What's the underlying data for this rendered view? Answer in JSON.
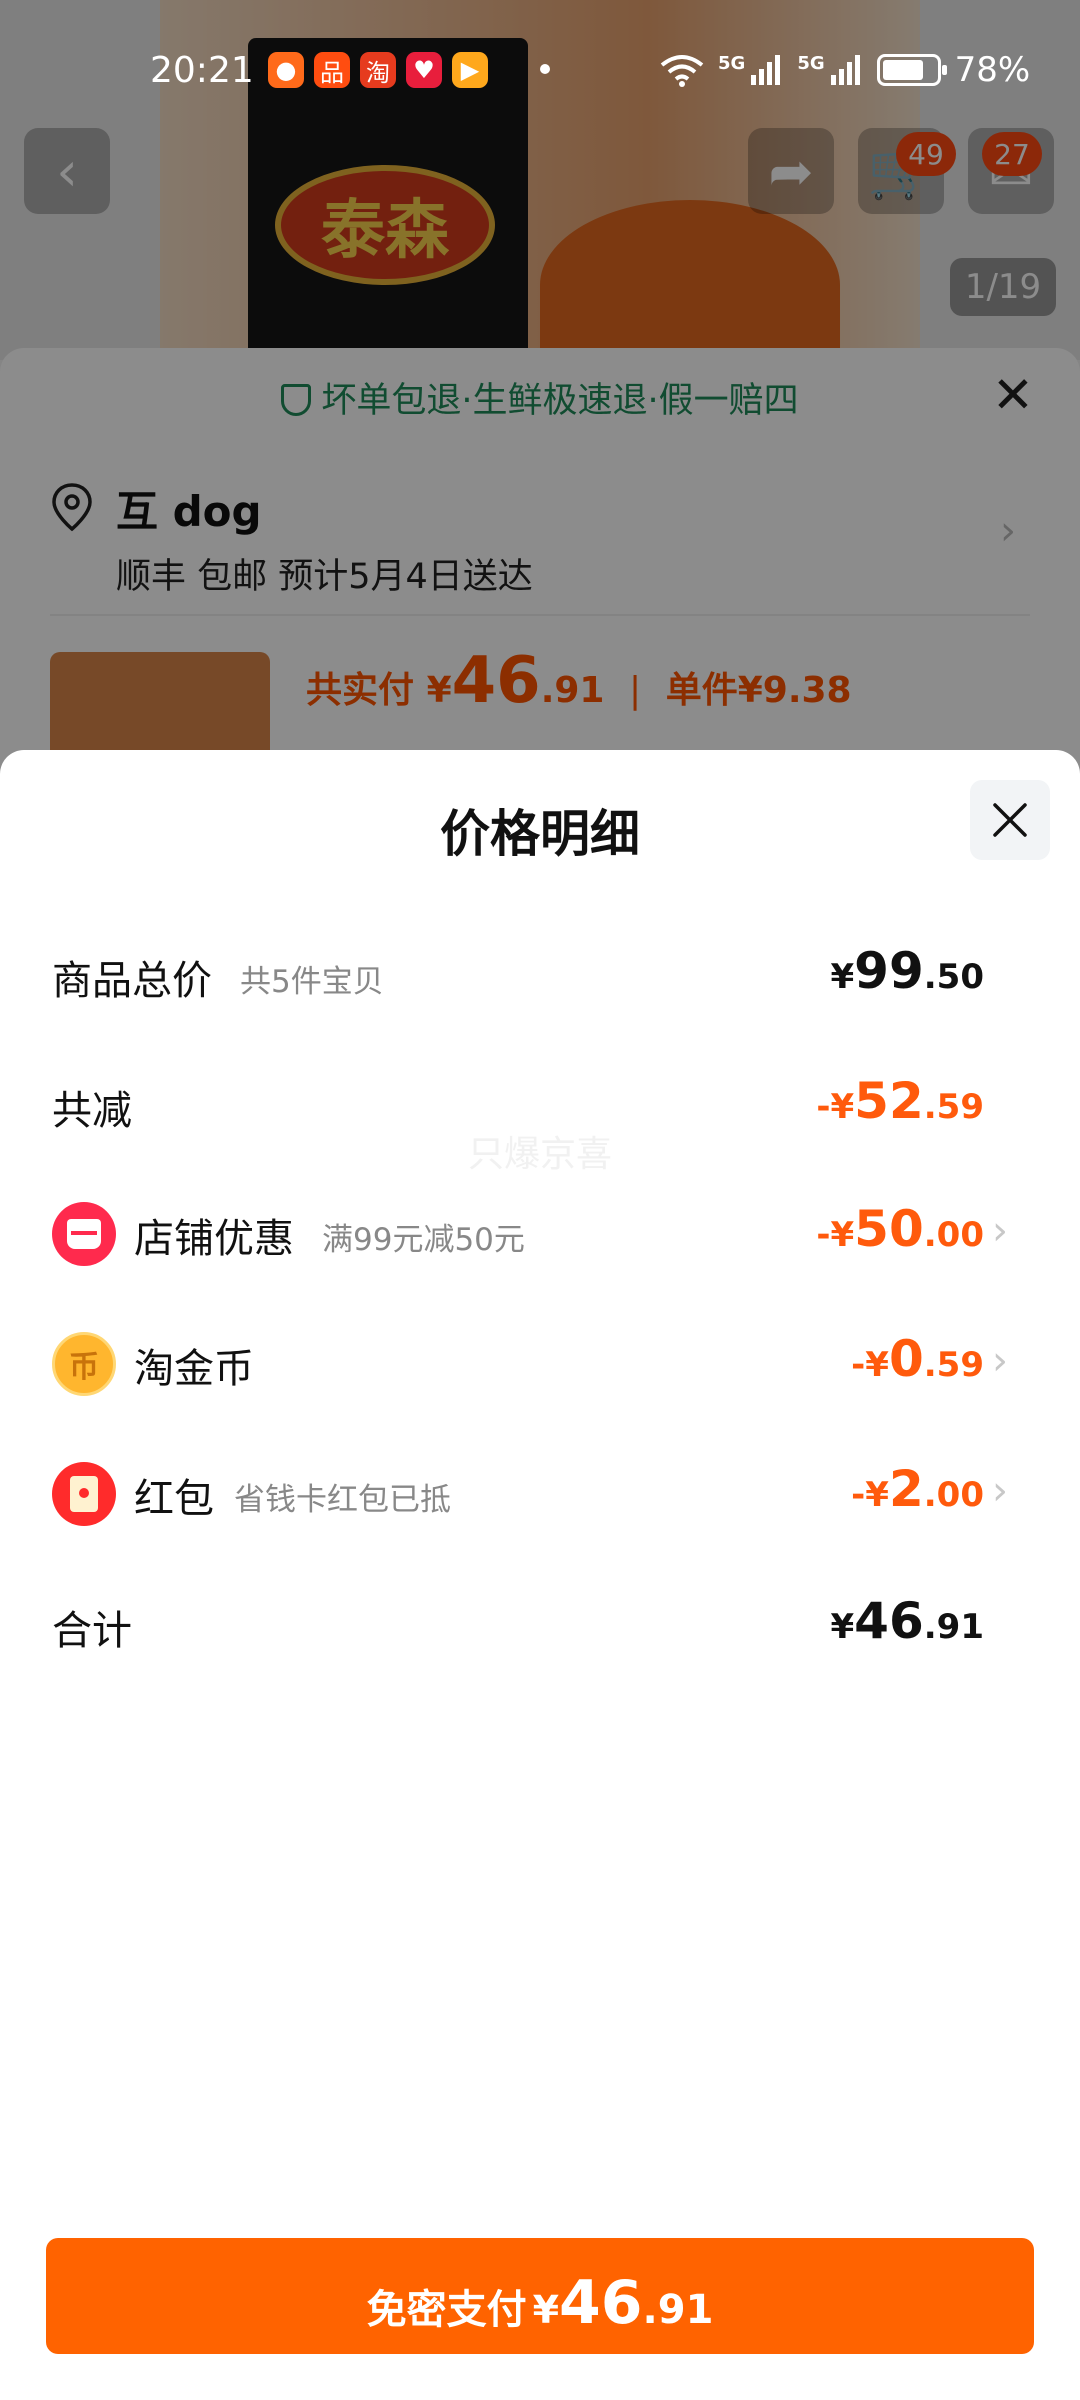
{
  "status_bar": {
    "time": "20:21",
    "app_icons": [
      {
        "name": "app-icon-1",
        "color": "#ff6a1a",
        "glyph": "●"
      },
      {
        "name": "app-icon-2",
        "color": "#ff4d10",
        "glyph": "品"
      },
      {
        "name": "taobao-icon",
        "color": "#e63b1e",
        "glyph": "淘"
      },
      {
        "name": "app-icon-4",
        "color": "#e81e3c",
        "glyph": "♥"
      },
      {
        "name": "app-icon-5",
        "color": "#ffa81c",
        "glyph": "▶"
      }
    ],
    "network_5g_1": "5G",
    "network_5g_2": "5G",
    "battery_percent": "78%"
  },
  "product_page": {
    "brand_logo_text": "泰森",
    "cart_badge": "49",
    "message_badge": "27",
    "image_counter": "1/19"
  },
  "order_sheet": {
    "guarantee_text": "坏单包退·生鲜极速退·假一赔四",
    "address_name": "互 dog",
    "delivery_text": "顺丰 包邮 预计5月4日送达",
    "total_paid_label": "共实付",
    "total_paid_currency": "¥",
    "total_paid_int": "46",
    "total_paid_dec": ".91",
    "unit_price_label": "单件",
    "unit_price": "¥9.38"
  },
  "price_detail": {
    "title": "价格明细",
    "watermark": "只爆京喜",
    "rows": [
      {
        "label": "商品总价",
        "sub": "共5件宝贝",
        "sign": "",
        "currency": "¥",
        "int": "99",
        "dec": ".50"
      },
      {
        "label": "共减",
        "sub": "",
        "sign": "-",
        "currency": "¥",
        "int": "52",
        "dec": ".59"
      },
      {
        "label": "店铺优惠",
        "sub": "满99元减50元",
        "sign": "-",
        "currency": "¥",
        "int": "50",
        "dec": ".00"
      },
      {
        "label": "淘金币",
        "sub": "",
        "sign": "-",
        "currency": "¥",
        "int": "0",
        "dec": ".59"
      },
      {
        "label": "红包",
        "sub": "省钱卡红包已抵",
        "sign": "-",
        "currency": "¥",
        "int": "2",
        "dec": ".00"
      },
      {
        "label": "合计",
        "sub": "",
        "sign": "",
        "currency": "¥",
        "int": "46",
        "dec": ".91"
      }
    ],
    "coin_glyph": "币"
  },
  "pay_button": {
    "label": "免密支付",
    "currency": "¥",
    "int": "46",
    "dec": ".91"
  },
  "colors": {
    "accent_orange": "#ff6300",
    "discount_orange": "#ff5a0c",
    "guarantee_green": "#1f8a5a",
    "shop_red": "#ff2a4d",
    "coin_gold": "#ffb62e"
  }
}
